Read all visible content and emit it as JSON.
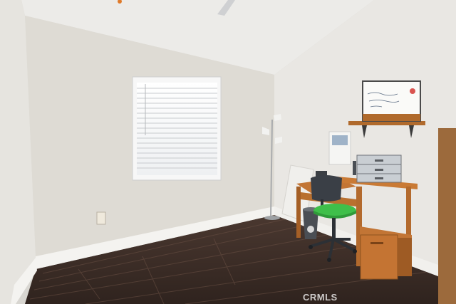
{
  "watermark": "CRMLS",
  "colors": {
    "wall_left": "#e4e2dd",
    "wall_back": "#dedbd4",
    "wall_right": "#e9e7e3",
    "ceiling": "#ecebe8",
    "floor_dark": "#3a2c26",
    "floor_light": "#5a4338",
    "baseboard": "#f4f3f0",
    "desk_wood": "#c97a35",
    "chair_seat": "#3fbf4a",
    "chair_frame": "#3a3f46"
  }
}
